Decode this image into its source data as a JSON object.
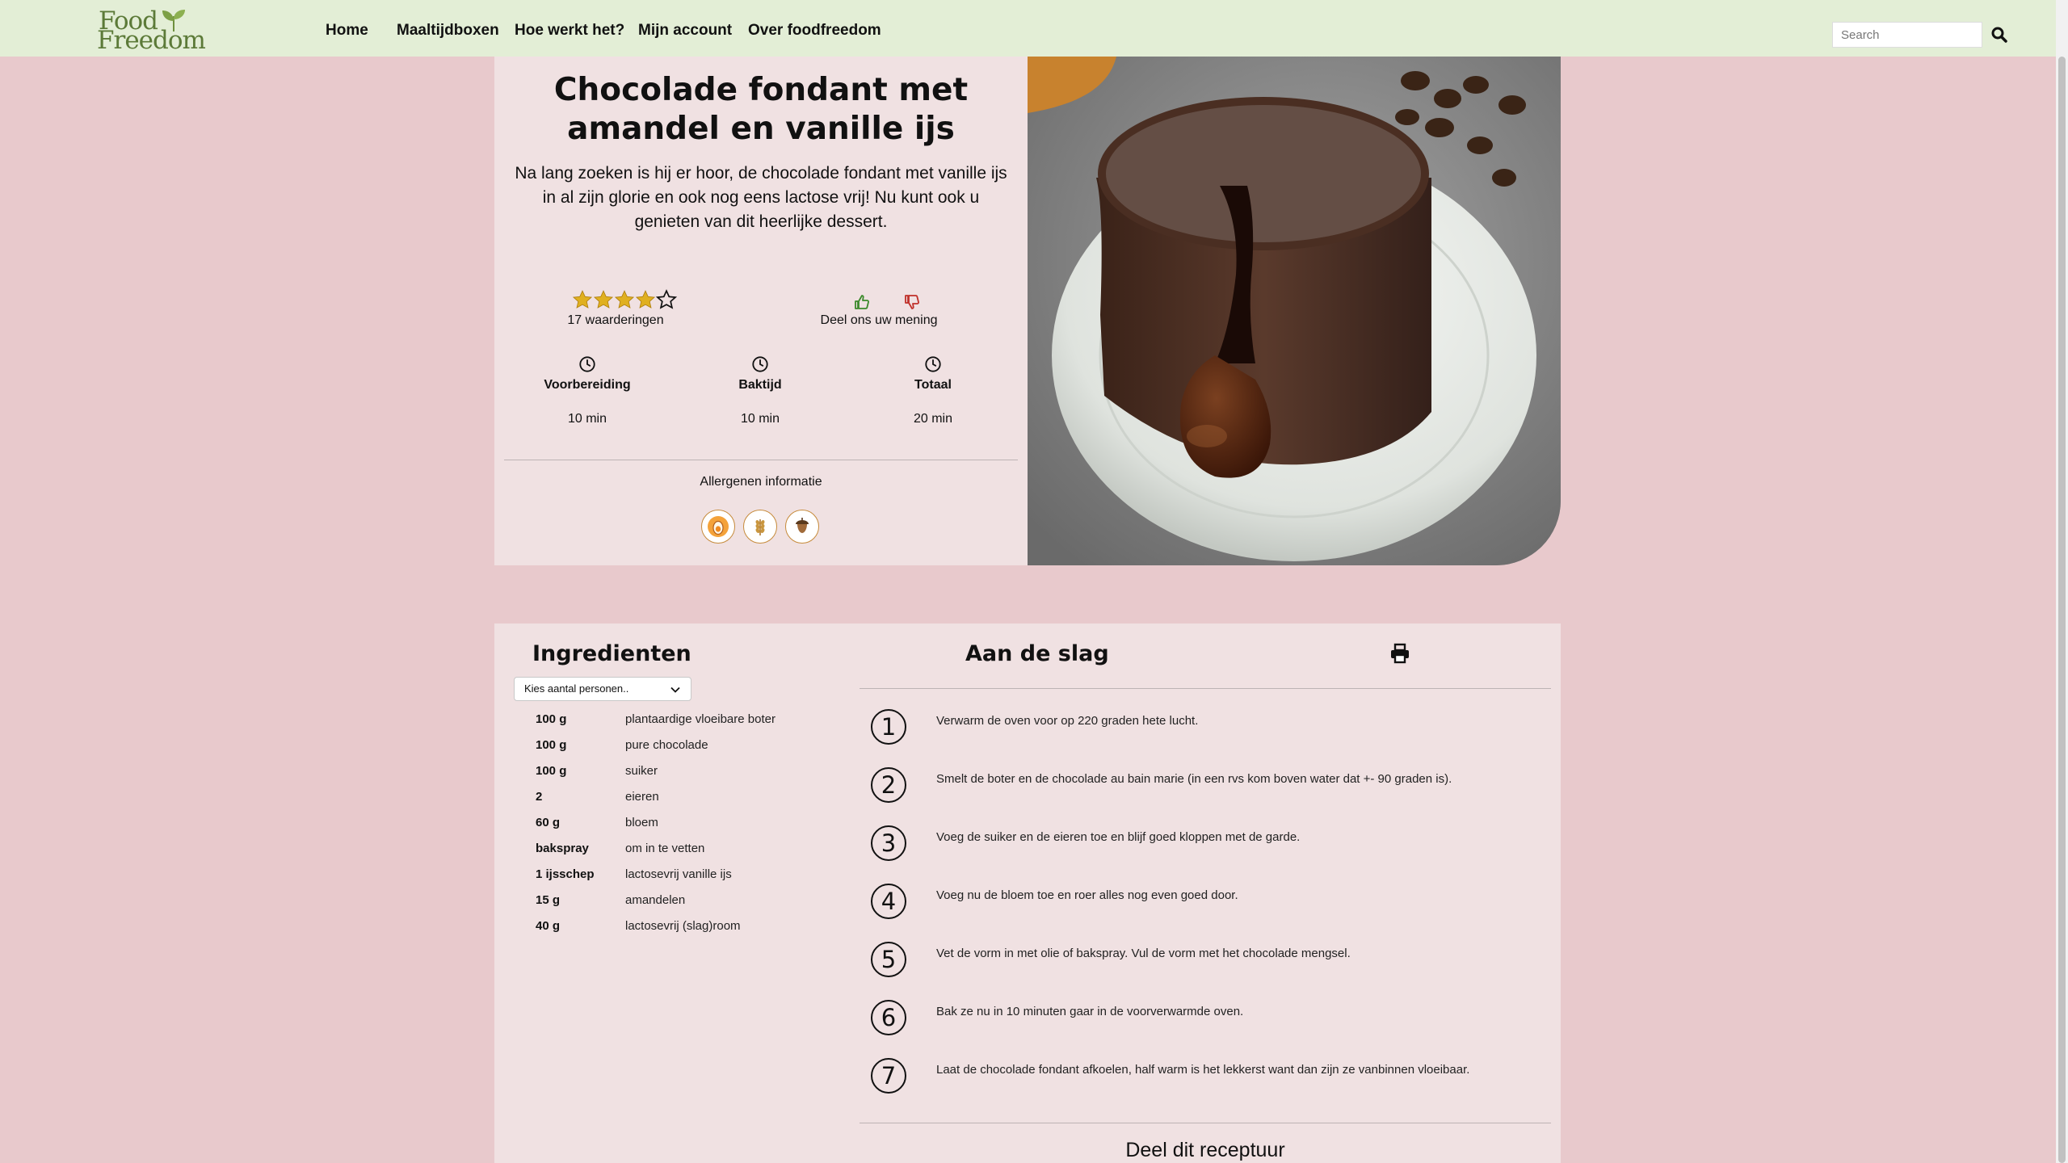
{
  "nav": {
    "logo_line1": "Food",
    "logo_line2": "Freedom",
    "links": [
      "Home",
      "Maaltijdboxen",
      "Hoe werkt het?",
      "Mijn account",
      "Over foodfreedom"
    ],
    "search_placeholder": "Search"
  },
  "recipe": {
    "title": "Chocolade fondant met amandel en vanille ijs",
    "intro": "Na lang zoeken is hij er hoor, de chocolade fondant met vanille ijs in al zijn glorie en ook nog eens lactose vrij! Nu kunt ook u genieten van dit heerlijke dessert.",
    "rating": {
      "stars_filled": 4,
      "stars_total": 5,
      "count_label": "17 waarderingen"
    },
    "opinion_label": "Deel ons uw mening",
    "times": [
      {
        "label": "Voorbereiding",
        "value": "10 min"
      },
      {
        "label": "Baktijd",
        "value": "10 min"
      },
      {
        "label": "Totaal",
        "value": "20 min"
      }
    ],
    "allergen_title": "Allergenen informatie",
    "allergens": [
      "egg-icon",
      "wheat-icon",
      "nut-icon"
    ],
    "image_alt": "chocolate-fondant-photo"
  },
  "ingredients": {
    "title": "Ingredienten",
    "persons_select": "Kies aantal personen..",
    "items": [
      {
        "amount": "100 g",
        "name": "plantaardige vloeibare boter"
      },
      {
        "amount": "100 g",
        "name": "pure chocolade"
      },
      {
        "amount": "100 g",
        "name": "suiker"
      },
      {
        "amount": "2",
        "name": "eieren"
      },
      {
        "amount": "60 g",
        "name": "bloem"
      },
      {
        "amount": "bakspray",
        "name": "om in te vetten"
      },
      {
        "amount": "1 ijsschep",
        "name": "lactosevrij vanille ijs"
      },
      {
        "amount": "15 g",
        "name": "amandelen"
      },
      {
        "amount": "40 g",
        "name": "lactosevrij (slag)room"
      }
    ]
  },
  "steps": {
    "title": "Aan de slag",
    "items": [
      {
        "num": "1",
        "text": "Verwarm de oven voor op 220 graden hete lucht."
      },
      {
        "num": "2",
        "text": "Smelt de boter en de chocolade au bain marie (in een rvs kom boven water dat +- 90 graden is)."
      },
      {
        "num": "3",
        "text": "Voeg de suiker en de eieren toe en blijf goed kloppen met de garde."
      },
      {
        "num": "4",
        "text": "Voeg nu de bloem toe en roer alles nog even goed door."
      },
      {
        "num": "5",
        "text": "Vet de vorm in met olie of bakspray. Vul de vorm met het chocolade mengsel."
      },
      {
        "num": "6",
        "text": "Bak ze nu in 10 minuten gaar in de voorverwarmde oven."
      },
      {
        "num": "7",
        "text": "Laat de chocolade fondant afkoelen, half warm is het lekkerst want dan zijn ze vanbinnen vloeibaar."
      }
    ],
    "share_title": "Deel dit receptuur"
  },
  "colors": {
    "page_bg": "#e8c9cc",
    "nav_bg": "#e3eed6",
    "panel_bg": "#f0e1e2",
    "logo_green": "#5c7a38",
    "star_gold": "#e0b020",
    "thumb_up": "#3c8a2c",
    "thumb_down": "#c0302a"
  }
}
